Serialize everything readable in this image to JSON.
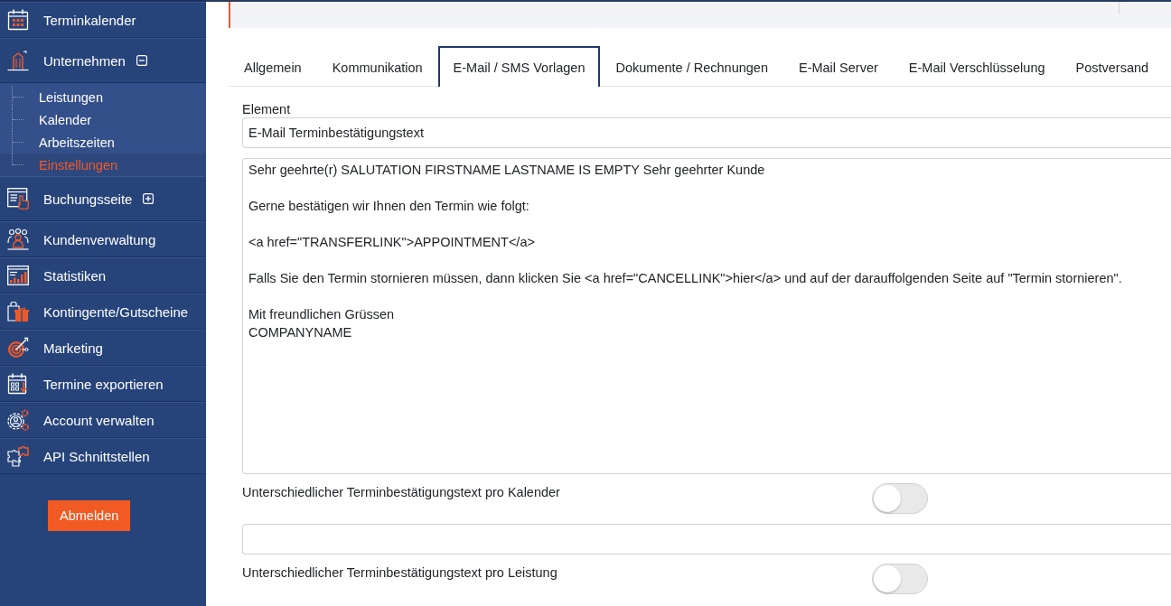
{
  "sidebar": {
    "items": [
      {
        "label": "Terminkalender",
        "selected": false
      },
      {
        "label": "Unternehmen",
        "selected": false,
        "expanded": true,
        "children": [
          {
            "label": "Leistungen",
            "selected": false
          },
          {
            "label": "Kalender",
            "selected": false
          },
          {
            "label": "Arbeitszeiten",
            "selected": false
          },
          {
            "label": "Einstellungen",
            "selected": true
          }
        ]
      },
      {
        "label": "Buchungsseite",
        "selected": false,
        "expanded": false
      },
      {
        "label": "Kundenverwaltung",
        "selected": false
      },
      {
        "label": "Statistiken",
        "selected": false
      },
      {
        "label": "Kontingente/Gutscheine",
        "selected": false
      },
      {
        "label": "Marketing",
        "selected": false
      },
      {
        "label": "Termine exportieren",
        "selected": false
      },
      {
        "label": "Account verwalten",
        "selected": false
      },
      {
        "label": "API Schnittstellen",
        "selected": false
      }
    ],
    "logout_button": "Abmelden"
  },
  "tabs": [
    {
      "label": "Allgemein",
      "selected": false
    },
    {
      "label": "Kommunikation",
      "selected": false
    },
    {
      "label": "E-Mail / SMS Vorlagen",
      "selected": true
    },
    {
      "label": "Dokumente / Rechnungen",
      "selected": false
    },
    {
      "label": "E-Mail Server",
      "selected": false
    },
    {
      "label": "E-Mail Verschlüsselung",
      "selected": false
    },
    {
      "label": "Postversand",
      "selected": false
    }
  ],
  "form": {
    "element": {
      "label": "Element",
      "value": "E-Mail Terminbestätigungstext"
    },
    "message": {
      "value": "Sehr geehrte(r) SALUTATION FIRSTNAME LASTNAME IS EMPTY Sehr geehrter Kunde\n\nGerne bestätigen wir Ihnen den Termin wie folgt:\n\n<a href=\"TRANSFERLINK\">APPOINTMENT</a>\n\nFalls Sie den Termin stornieren müssen, dann klicken Sie <a href=\"CANCELLINK\">hier</a> und auf der darauffolgenden Seite auf \"Termin stornieren\".\n\nMit freundlichen Grüssen\nCOMPANYNAME"
    },
    "rows": [
      {
        "kind": "toggle",
        "label": "Unterschiedlicher Terminbestätigungstext pro Kalender",
        "on": false
      },
      {
        "kind": "text-field"
      },
      {
        "kind": "toggle",
        "label": "Unterschiedlicher Terminbestätigungstext pro Leistung",
        "on": false
      }
    ]
  }
}
